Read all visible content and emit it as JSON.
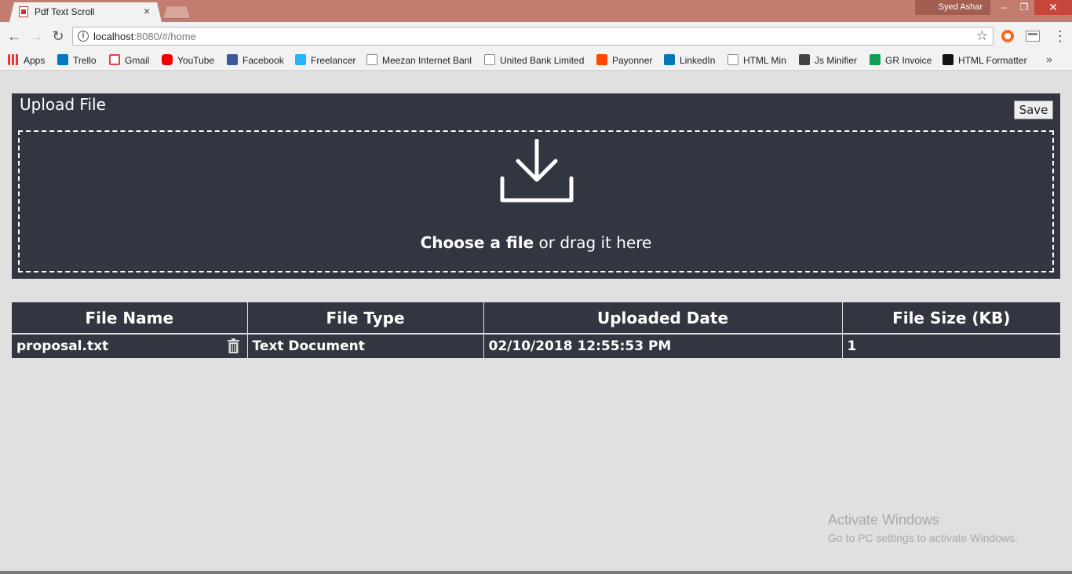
{
  "browser": {
    "tab_title": "Pdf Text Scroll",
    "tab_close": "×",
    "profile_name": "Syed Ashar",
    "url_host": "localhost",
    "url_rest": ":8080/#/home",
    "window_min": "–",
    "window_max": "❐",
    "window_close": "✕"
  },
  "bookmarks": [
    {
      "label": "Apps",
      "icon_color": "#e33"
    },
    {
      "label": "Trello",
      "icon_color": "#0079bf"
    },
    {
      "label": "Gmail",
      "icon_color": "#d44"
    },
    {
      "label": "YouTube",
      "icon_color": "#e00"
    },
    {
      "label": "Facebook",
      "icon_color": "#3b5998"
    },
    {
      "label": "Freelancer",
      "icon_color": "#29b2fe"
    },
    {
      "label": "Meezan Internet Banl",
      "icon_color": "#ffffff"
    },
    {
      "label": "United Bank Limited",
      "icon_color": "#ffffff"
    },
    {
      "label": "Payonner",
      "icon_color": "#ff4800"
    },
    {
      "label": "LinkedIn",
      "icon_color": "#0077b5"
    },
    {
      "label": "HTML Min",
      "icon_color": "#ffffff"
    },
    {
      "label": "Js Minifier",
      "icon_color": "#444444"
    },
    {
      "label": "GR Invoice",
      "icon_color": "#0f9d58"
    },
    {
      "label": "HTML Formatter",
      "icon_color": "#111111"
    }
  ],
  "bookmarks_more": "»",
  "upload": {
    "title": "Upload File",
    "save_label": "Save",
    "choose_bold": "Choose a file",
    "choose_rest": " or drag it here"
  },
  "table": {
    "headers": [
      "File Name",
      "File Type",
      "Uploaded Date",
      "File Size (KB)"
    ],
    "rows": [
      {
        "name": "proposal.txt",
        "type": "Text Document",
        "date": "02/10/2018 12:55:53 PM",
        "size": "1"
      }
    ]
  },
  "watermark": {
    "title": "Activate Windows",
    "subtitle": "Go to PC settings to activate Windows."
  }
}
